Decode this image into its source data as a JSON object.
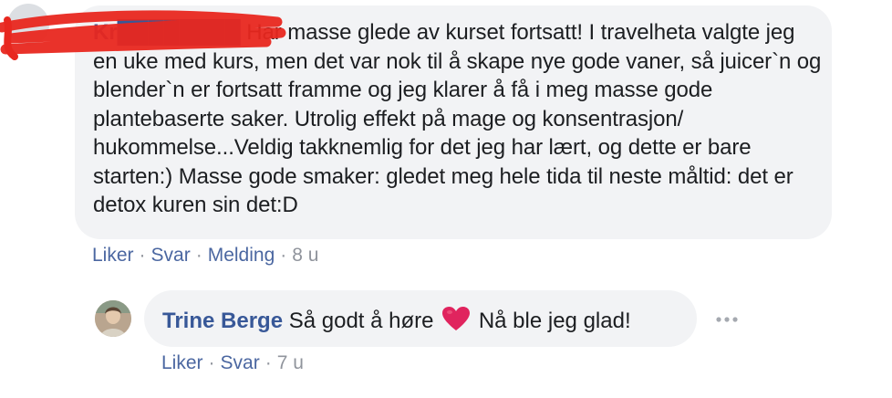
{
  "top_comment": {
    "author": "Kr████████",
    "text": "Har masse glede av kurset fortsatt! I travelheta valgte jeg en uke med kurs, men det var nok til å skape nye gode vaner, så juicer`n og blender`n er fortsatt framme og jeg klarer å få i meg masse gode plantebaserte saker. Utrolig effekt på mage og konsentrasjon/ hukommelse...Veldig takknemlig for det jeg har lært, og dette er bare starten:) Masse gode smaker: gledet meg hele tida til neste måltid: det er detox kuren sin det:D",
    "actions": {
      "like": "Liker",
      "reply": "Svar",
      "message": "Melding",
      "separator": "·",
      "time": "8 u"
    }
  },
  "reply": {
    "author": "Trine Berge",
    "text_before": "Så godt å høre",
    "emoji": "heart-icon",
    "text_after": "Nå ble jeg glad!",
    "actions": {
      "like": "Liker",
      "reply": "Svar",
      "separator": "·",
      "time": "7 u"
    },
    "more_icon": "ellipsis-icon"
  },
  "colors": {
    "link": "#385898",
    "action_link": "#4b67a1",
    "muted": "#90949c",
    "bubble": "#f2f3f5",
    "redaction": "#e8271f",
    "heart": "#e0245e"
  }
}
